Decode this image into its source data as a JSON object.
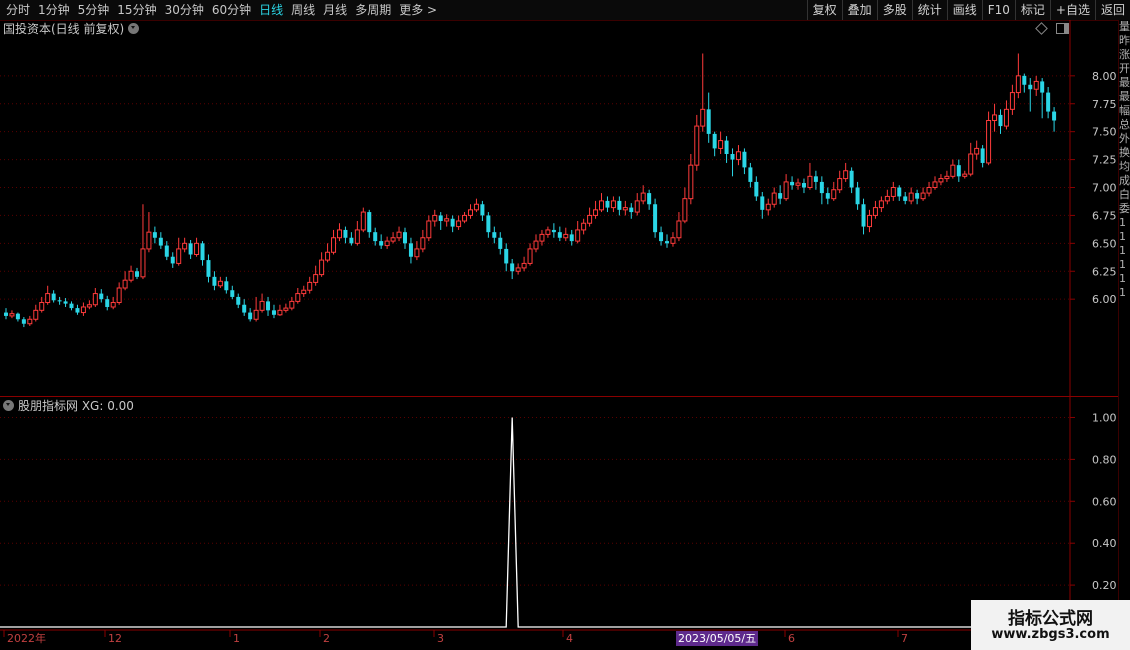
{
  "toolbar": {
    "periods": [
      "分时",
      "1分钟",
      "5分钟",
      "15分钟",
      "30分钟",
      "60分钟",
      "日线",
      "周线",
      "月线",
      "多周期",
      "更多 >"
    ],
    "active_period": "日线",
    "actions": [
      "复权",
      "叠加",
      "多股",
      "统计",
      "画线",
      "F10",
      "标记",
      "+自选",
      "返回"
    ]
  },
  "main_chart": {
    "title": "国投资本(日线 前复权)",
    "price_ticks": [
      "8.00",
      "7.75",
      "7.50",
      "7.25",
      "7.00",
      "6.75",
      "6.50",
      "6.25",
      "6.00"
    ],
    "price_range": [
      5.5,
      8.5
    ]
  },
  "sub_chart": {
    "title": "股朋指标网 XG: 0.00",
    "ticks": [
      "1.00",
      "0.80",
      "0.60",
      "0.40",
      "0.20"
    ]
  },
  "time_axis": {
    "labels": [
      "2022年",
      "12",
      "1",
      "2",
      "3",
      "4",
      "6",
      "7"
    ],
    "cursor_date": "2023/05/05/五"
  },
  "right_strip": [
    "量",
    "昨",
    "涨",
    "开",
    "最",
    "最",
    "幅",
    "总",
    "外",
    "换",
    "均",
    "成",
    "白",
    "委",
    "1",
    "1",
    "1",
    "1",
    "1",
    "1"
  ],
  "watermark": {
    "title": "指标公式网",
    "url": "www.zbgs3.com"
  },
  "colors": {
    "up": "#ff3b3b",
    "down": "#2bd6e6",
    "grid": "#5a0000",
    "axis": "#8a0000",
    "signal": "#ffffff"
  },
  "chart_data": {
    "type": "candlestick",
    "title": "国投资本(日线 前复权)",
    "candles": [
      [
        5.88,
        5.85,
        5.92,
        5.82
      ],
      [
        5.85,
        5.87,
        5.9,
        5.83
      ],
      [
        5.87,
        5.82,
        5.88,
        5.8
      ],
      [
        5.82,
        5.78,
        5.84,
        5.75
      ],
      [
        5.78,
        5.82,
        5.85,
        5.76
      ],
      [
        5.82,
        5.9,
        5.95,
        5.8
      ],
      [
        5.9,
        5.97,
        6.02,
        5.88
      ],
      [
        5.97,
        6.05,
        6.12,
        5.95
      ],
      [
        6.05,
        5.99,
        6.08,
        5.97
      ],
      [
        5.99,
        5.98,
        6.02,
        5.95
      ],
      [
        5.98,
        5.96,
        6.01,
        5.93
      ],
      [
        5.96,
        5.92,
        5.98,
        5.9
      ],
      [
        5.92,
        5.88,
        5.95,
        5.86
      ],
      [
        5.88,
        5.93,
        5.97,
        5.85
      ],
      [
        5.93,
        5.95,
        5.99,
        5.91
      ],
      [
        5.95,
        6.05,
        6.1,
        5.93
      ],
      [
        6.05,
        6.0,
        6.09,
        5.97
      ],
      [
        6.0,
        5.93,
        6.03,
        5.9
      ],
      [
        5.93,
        5.97,
        6.02,
        5.91
      ],
      [
        5.97,
        6.1,
        6.15,
        5.95
      ],
      [
        6.1,
        6.17,
        6.25,
        6.08
      ],
      [
        6.17,
        6.25,
        6.3,
        6.15
      ],
      [
        6.25,
        6.2,
        6.28,
        6.18
      ],
      [
        6.2,
        6.45,
        6.85,
        6.18
      ],
      [
        6.45,
        6.6,
        6.78,
        6.42
      ],
      [
        6.6,
        6.55,
        6.65,
        6.5
      ],
      [
        6.55,
        6.48,
        6.6,
        6.45
      ],
      [
        6.48,
        6.38,
        6.52,
        6.35
      ],
      [
        6.38,
        6.32,
        6.42,
        6.28
      ],
      [
        6.32,
        6.45,
        6.55,
        6.3
      ],
      [
        6.45,
        6.5,
        6.55,
        6.42
      ],
      [
        6.5,
        6.4,
        6.53,
        6.36
      ],
      [
        6.4,
        6.5,
        6.55,
        6.38
      ],
      [
        6.5,
        6.35,
        6.52,
        6.3
      ],
      [
        6.35,
        6.2,
        6.4,
        6.15
      ],
      [
        6.2,
        6.12,
        6.25,
        6.08
      ],
      [
        6.12,
        6.16,
        6.2,
        6.1
      ],
      [
        6.16,
        6.08,
        6.2,
        6.05
      ],
      [
        6.08,
        6.02,
        6.12,
        6.0
      ],
      [
        6.02,
        5.95,
        6.05,
        5.92
      ],
      [
        5.95,
        5.88,
        6.0,
        5.85
      ],
      [
        5.88,
        5.82,
        5.92,
        5.8
      ],
      [
        5.82,
        5.9,
        6.02,
        5.8
      ],
      [
        5.9,
        5.98,
        6.05,
        5.88
      ],
      [
        5.98,
        5.9,
        6.02,
        5.85
      ],
      [
        5.9,
        5.86,
        5.95,
        5.83
      ],
      [
        5.86,
        5.9,
        5.95,
        5.85
      ],
      [
        5.9,
        5.92,
        5.96,
        5.88
      ],
      [
        5.92,
        5.98,
        6.02,
        5.9
      ],
      [
        5.98,
        6.05,
        6.1,
        5.96
      ],
      [
        6.05,
        6.08,
        6.12,
        6.02
      ],
      [
        6.08,
        6.15,
        6.2,
        6.05
      ],
      [
        6.15,
        6.22,
        6.3,
        6.12
      ],
      [
        6.22,
        6.35,
        6.42,
        6.2
      ],
      [
        6.35,
        6.42,
        6.5,
        6.33
      ],
      [
        6.42,
        6.55,
        6.62,
        6.4
      ],
      [
        6.55,
        6.62,
        6.68,
        6.52
      ],
      [
        6.62,
        6.55,
        6.65,
        6.5
      ],
      [
        6.55,
        6.5,
        6.6,
        6.48
      ],
      [
        6.5,
        6.62,
        6.7,
        6.48
      ],
      [
        6.62,
        6.78,
        6.82,
        6.6
      ],
      [
        6.78,
        6.6,
        6.8,
        6.55
      ],
      [
        6.6,
        6.52,
        6.64,
        6.48
      ],
      [
        6.52,
        6.48,
        6.58,
        6.45
      ],
      [
        6.48,
        6.52,
        6.56,
        6.45
      ],
      [
        6.52,
        6.55,
        6.6,
        6.5
      ],
      [
        6.55,
        6.6,
        6.65,
        6.52
      ],
      [
        6.6,
        6.5,
        6.64,
        6.45
      ],
      [
        6.5,
        6.38,
        6.55,
        6.32
      ],
      [
        6.38,
        6.45,
        6.52,
        6.35
      ],
      [
        6.45,
        6.55,
        6.62,
        6.42
      ],
      [
        6.55,
        6.7,
        6.75,
        6.52
      ],
      [
        6.7,
        6.75,
        6.8,
        6.65
      ],
      [
        6.75,
        6.7,
        6.78,
        6.62
      ],
      [
        6.7,
        6.72,
        6.76,
        6.65
      ],
      [
        6.72,
        6.65,
        6.75,
        6.6
      ],
      [
        6.65,
        6.7,
        6.75,
        6.62
      ],
      [
        6.7,
        6.75,
        6.78,
        6.68
      ],
      [
        6.75,
        6.8,
        6.85,
        6.72
      ],
      [
        6.8,
        6.85,
        6.9,
        6.78
      ],
      [
        6.85,
        6.75,
        6.88,
        6.7
      ],
      [
        6.75,
        6.6,
        6.78,
        6.55
      ],
      [
        6.6,
        6.55,
        6.65,
        6.5
      ],
      [
        6.55,
        6.45,
        6.6,
        6.4
      ],
      [
        6.45,
        6.32,
        6.5,
        6.25
      ],
      [
        6.32,
        6.25,
        6.36,
        6.18
      ],
      [
        6.25,
        6.28,
        6.32,
        6.22
      ],
      [
        6.28,
        6.32,
        6.38,
        6.25
      ],
      [
        6.32,
        6.45,
        6.5,
        6.3
      ],
      [
        6.45,
        6.52,
        6.58,
        6.42
      ],
      [
        6.52,
        6.58,
        6.62,
        6.48
      ],
      [
        6.58,
        6.62,
        6.65,
        6.55
      ],
      [
        6.62,
        6.6,
        6.68,
        6.55
      ],
      [
        6.6,
        6.55,
        6.65,
        6.52
      ],
      [
        6.55,
        6.58,
        6.64,
        6.52
      ],
      [
        6.58,
        6.52,
        6.62,
        6.48
      ],
      [
        6.52,
        6.62,
        6.7,
        6.5
      ],
      [
        6.62,
        6.68,
        6.72,
        6.58
      ],
      [
        6.68,
        6.75,
        6.82,
        6.65
      ],
      [
        6.75,
        6.8,
        6.88,
        6.72
      ],
      [
        6.8,
        6.88,
        6.95,
        6.78
      ],
      [
        6.88,
        6.82,
        6.92,
        6.78
      ],
      [
        6.82,
        6.88,
        6.92,
        6.78
      ],
      [
        6.88,
        6.8,
        6.92,
        6.75
      ],
      [
        6.8,
        6.82,
        6.88,
        6.75
      ],
      [
        6.82,
        6.78,
        6.86,
        6.72
      ],
      [
        6.78,
        6.88,
        6.95,
        6.75
      ],
      [
        6.88,
        6.95,
        7.02,
        6.85
      ],
      [
        6.95,
        6.85,
        6.98,
        6.8
      ],
      [
        6.85,
        6.6,
        6.9,
        6.55
      ],
      [
        6.6,
        6.52,
        6.65,
        6.48
      ],
      [
        6.52,
        6.5,
        6.58,
        6.46
      ],
      [
        6.5,
        6.55,
        6.6,
        6.47
      ],
      [
        6.55,
        6.7,
        6.78,
        6.52
      ],
      [
        6.7,
        6.9,
        7.0,
        6.68
      ],
      [
        6.9,
        7.2,
        7.3,
        6.85
      ],
      [
        7.2,
        7.55,
        7.65,
        7.15
      ],
      [
        7.55,
        7.7,
        8.2,
        7.5
      ],
      [
        7.7,
        7.48,
        7.85,
        7.4
      ],
      [
        7.48,
        7.35,
        7.5,
        7.28
      ],
      [
        7.35,
        7.42,
        7.5,
        7.3
      ],
      [
        7.42,
        7.3,
        7.46,
        7.22
      ],
      [
        7.3,
        7.25,
        7.35,
        7.1
      ],
      [
        7.25,
        7.32,
        7.38,
        7.2
      ],
      [
        7.32,
        7.18,
        7.35,
        7.12
      ],
      [
        7.18,
        7.05,
        7.22,
        7.0
      ],
      [
        7.05,
        6.92,
        7.1,
        6.88
      ],
      [
        6.92,
        6.8,
        6.96,
        6.72
      ],
      [
        6.8,
        6.85,
        6.9,
        6.75
      ],
      [
        6.85,
        6.95,
        7.0,
        6.82
      ],
      [
        6.95,
        6.9,
        7.02,
        6.85
      ],
      [
        6.9,
        7.05,
        7.12,
        6.88
      ],
      [
        7.05,
        7.02,
        7.1,
        6.98
      ],
      [
        7.02,
        7.04,
        7.08,
        6.98
      ],
      [
        7.04,
        7.0,
        7.08,
        6.95
      ],
      [
        7.0,
        7.1,
        7.22,
        6.98
      ],
      [
        7.1,
        7.05,
        7.15,
        6.98
      ],
      [
        7.05,
        6.95,
        7.1,
        6.85
      ],
      [
        6.95,
        6.9,
        7.0,
        6.85
      ],
      [
        6.9,
        6.98,
        7.05,
        6.88
      ],
      [
        6.98,
        7.08,
        7.15,
        6.95
      ],
      [
        7.08,
        7.15,
        7.22,
        7.05
      ],
      [
        7.15,
        7.0,
        7.18,
        6.95
      ],
      [
        7.0,
        6.85,
        7.05,
        6.8
      ],
      [
        6.85,
        6.65,
        6.9,
        6.58
      ],
      [
        6.65,
        6.75,
        6.8,
        6.6
      ],
      [
        6.75,
        6.82,
        6.88,
        6.72
      ],
      [
        6.82,
        6.88,
        6.92,
        6.78
      ],
      [
        6.88,
        6.92,
        6.98,
        6.85
      ],
      [
        6.92,
        7.0,
        7.05,
        6.88
      ],
      [
        7.0,
        6.92,
        7.02,
        6.88
      ],
      [
        6.92,
        6.88,
        6.96,
        6.85
      ],
      [
        6.88,
        6.95,
        7.0,
        6.85
      ],
      [
        6.95,
        6.9,
        6.98,
        6.85
      ],
      [
        6.9,
        6.95,
        7.0,
        6.88
      ],
      [
        6.95,
        7.0,
        7.05,
        6.92
      ],
      [
        7.0,
        7.05,
        7.1,
        6.98
      ],
      [
        7.05,
        7.08,
        7.12,
        7.02
      ],
      [
        7.08,
        7.1,
        7.15,
        7.05
      ],
      [
        7.1,
        7.2,
        7.25,
        7.08
      ],
      [
        7.2,
        7.1,
        7.25,
        7.05
      ],
      [
        7.1,
        7.12,
        7.15,
        7.08
      ],
      [
        7.12,
        7.3,
        7.4,
        7.1
      ],
      [
        7.3,
        7.35,
        7.42,
        7.25
      ],
      [
        7.35,
        7.22,
        7.38,
        7.18
      ],
      [
        7.22,
        7.6,
        7.68,
        7.2
      ],
      [
        7.6,
        7.65,
        7.75,
        7.5
      ],
      [
        7.65,
        7.55,
        7.7,
        7.48
      ],
      [
        7.55,
        7.7,
        7.78,
        7.52
      ],
      [
        7.7,
        7.85,
        7.92,
        7.65
      ],
      [
        7.85,
        8.0,
        8.2,
        7.8
      ],
      [
        8.0,
        7.92,
        8.02,
        7.85
      ],
      [
        7.92,
        7.88,
        7.98,
        7.68
      ],
      [
        7.88,
        7.95,
        8.0,
        7.82
      ],
      [
        7.95,
        7.85,
        7.98,
        7.62
      ],
      [
        7.85,
        7.68,
        7.9,
        7.62
      ],
      [
        7.68,
        7.6,
        7.72,
        7.5
      ]
    ],
    "xg_signal": {
      "index": 85,
      "value": 1.0,
      "baseline": 0.0,
      "ylim": [
        0,
        1.05
      ]
    }
  }
}
